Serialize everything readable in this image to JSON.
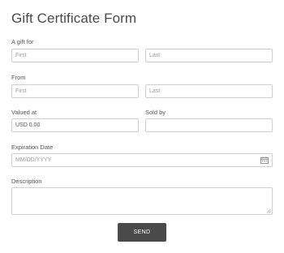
{
  "form": {
    "title": "Gift Certificate Form",
    "gift_for": {
      "label": "A gift for",
      "first_placeholder": "First",
      "last_placeholder": "Last"
    },
    "from": {
      "label": "From",
      "first_placeholder": "First",
      "last_placeholder": "Last"
    },
    "valued_at": {
      "label": "Valued at",
      "value": "USD  0.00"
    },
    "sold_by": {
      "label": "Sold by",
      "value": ""
    },
    "expiration": {
      "label": "Expiration Date",
      "placeholder": "MM/DD/YYYY",
      "icon": "calendar-icon"
    },
    "description": {
      "label": "Description",
      "value": ""
    },
    "submit_label": "SEND"
  },
  "colors": {
    "button_bg": "#4a4a4a",
    "border": "#cfcfcf",
    "title": "#4a4a4a"
  }
}
